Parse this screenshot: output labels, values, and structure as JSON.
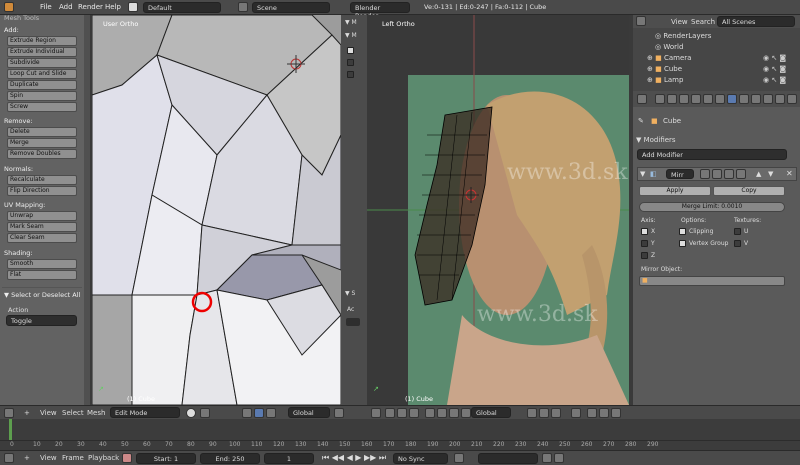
{
  "topbar": {
    "menus": [
      "File",
      "Add",
      "Render",
      "Help"
    ],
    "screen_layout": "Default",
    "scene": "Scene",
    "render_engine": "Blender Render",
    "stats": "Ve:0-131 | Ed:0-247 | Fa:0-112 | Cube"
  },
  "toolshelf": {
    "header": "Mesh Tools",
    "add_label": "Add:",
    "add_buttons": [
      "Extrude Region",
      "Extrude Individual",
      "Subdivide",
      "Loop Cut and Slide",
      "Duplicate",
      "Spin",
      "Screw"
    ],
    "remove_label": "Remove:",
    "remove_buttons": [
      "Delete",
      "Merge",
      "Remove Doubles"
    ],
    "normals_label": "Normals:",
    "normals_buttons": [
      "Recalculate",
      "Flip Direction"
    ],
    "uv_label": "UV Mapping:",
    "uv_buttons": [
      "Unwrap",
      "Mark Seam",
      "Clear Seam"
    ],
    "shading_label": "Shading:",
    "shading_buttons": [
      "Smooth",
      "Flat"
    ],
    "operator_title": "Select or Deselect All",
    "action_label": "Action",
    "action_value": "Toggle"
  },
  "viewport_left": {
    "label": "User Ortho",
    "object": "(1) Cube"
  },
  "viewport_right": {
    "label": "Left Ortho",
    "object": "(1) Cube",
    "watermark": "www.3d.sk",
    "side_letters": [
      "M",
      "M",
      "S",
      "Ac"
    ]
  },
  "outliner": {
    "view": "View",
    "search": "Search",
    "filter": "All Scenes",
    "items": [
      "RenderLayers",
      "World",
      "Camera",
      "Cube",
      "Lamp"
    ]
  },
  "properties": {
    "object_name": "Cube",
    "modifiers_title": "Modifiers",
    "add_modifier": "Add Modifier",
    "modifier_name": "Mirr",
    "apply": "Apply",
    "copy": "Copy",
    "merge_limit": "Merge Limit: 0.0010",
    "axis_label": "Axis:",
    "options_label": "Options:",
    "textures_label": "Textures:",
    "axes": [
      "X",
      "Y",
      "Z"
    ],
    "options": [
      "Clipping",
      "Vertex Group"
    ],
    "textures": [
      "U",
      "V"
    ],
    "mirror_object_label": "Mirror Object:"
  },
  "viewport_header_left": {
    "menus": [
      "View",
      "Select",
      "Mesh"
    ],
    "mode": "Edit Mode",
    "orientation": "Global"
  },
  "viewport_header_right": {
    "orientation": "Global"
  },
  "timeline": {
    "ticks": [
      "0",
      "10",
      "20",
      "30",
      "40",
      "50",
      "60",
      "70",
      "80",
      "90",
      "100",
      "110",
      "120",
      "130",
      "140",
      "150",
      "160",
      "170",
      "180",
      "190",
      "200",
      "210",
      "220",
      "230",
      "240",
      "250",
      "260",
      "270",
      "280",
      "290"
    ]
  },
  "bottombar": {
    "menus": [
      "View",
      "Frame",
      "Playback"
    ],
    "start": "Start: 1",
    "end": "End: 250",
    "current": "1",
    "sync": "No Sync"
  }
}
